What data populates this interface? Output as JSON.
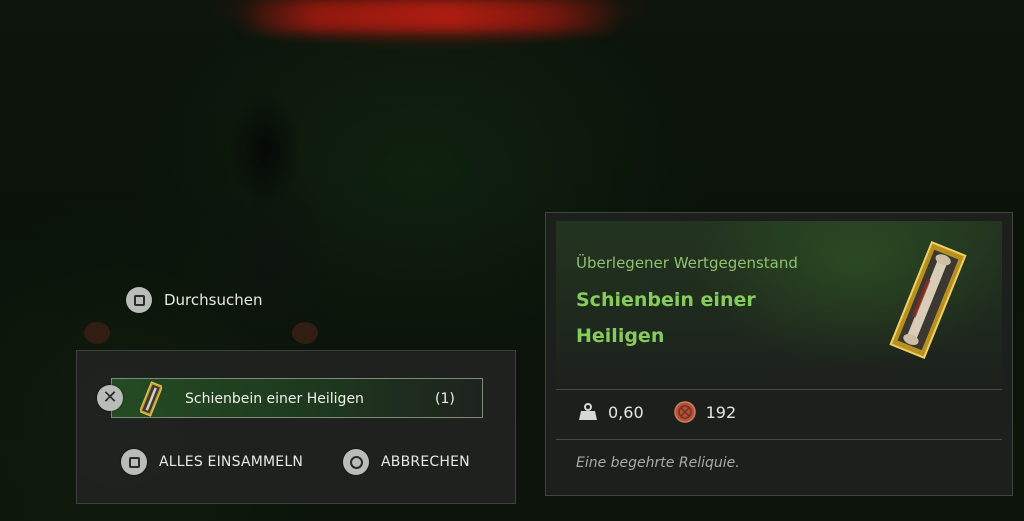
{
  "prompt": {
    "search_label": "Durchsuchen",
    "search_icon": "square-button-icon"
  },
  "loot": {
    "items": [
      {
        "name": "Schienbein einer Heiligen",
        "quantity": "(1)",
        "icon": "relic-bone-icon"
      }
    ],
    "select_icon": "cross-button-icon",
    "actions": {
      "collect_all_label": "ALLES EINSAMMELN",
      "collect_all_icon": "square-button-icon",
      "cancel_label": "ABBRECHEN",
      "cancel_icon": "circle-button-icon"
    }
  },
  "tooltip": {
    "rarity": "Überlegener Wertgegenstand",
    "title_line1": "Schienbein einer",
    "title_line2": "Heiligen",
    "weight": "0,60",
    "value": "192",
    "weight_icon": "weight-icon",
    "value_icon": "coin-icon",
    "description": "Eine begehrte Reliquie.",
    "rarity_color": "#8fc06f",
    "title_color": "#86cc5a"
  }
}
